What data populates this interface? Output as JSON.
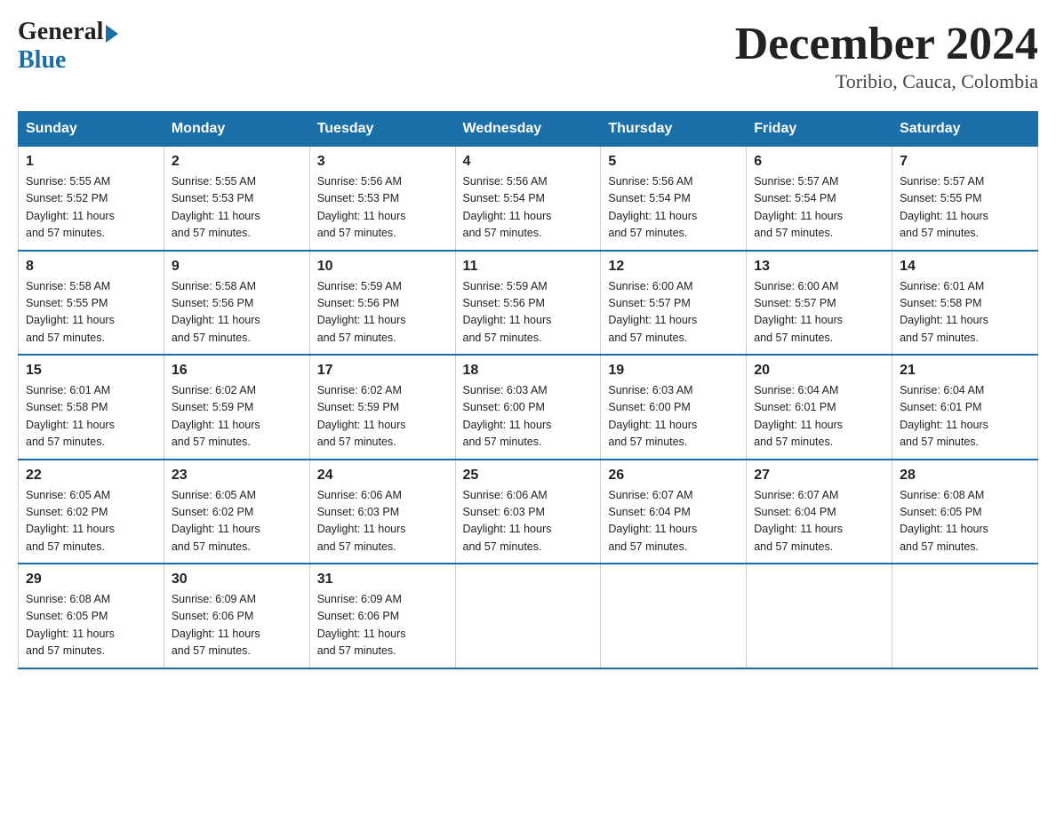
{
  "logo": {
    "general": "General",
    "blue": "Blue"
  },
  "title": "December 2024",
  "location": "Toribio, Cauca, Colombia",
  "days_of_week": [
    "Sunday",
    "Monday",
    "Tuesday",
    "Wednesday",
    "Thursday",
    "Friday",
    "Saturday"
  ],
  "weeks": [
    [
      {
        "day": "1",
        "sunrise": "5:55 AM",
        "sunset": "5:52 PM",
        "daylight": "11 hours and 57 minutes."
      },
      {
        "day": "2",
        "sunrise": "5:55 AM",
        "sunset": "5:53 PM",
        "daylight": "11 hours and 57 minutes."
      },
      {
        "day": "3",
        "sunrise": "5:56 AM",
        "sunset": "5:53 PM",
        "daylight": "11 hours and 57 minutes."
      },
      {
        "day": "4",
        "sunrise": "5:56 AM",
        "sunset": "5:54 PM",
        "daylight": "11 hours and 57 minutes."
      },
      {
        "day": "5",
        "sunrise": "5:56 AM",
        "sunset": "5:54 PM",
        "daylight": "11 hours and 57 minutes."
      },
      {
        "day": "6",
        "sunrise": "5:57 AM",
        "sunset": "5:54 PM",
        "daylight": "11 hours and 57 minutes."
      },
      {
        "day": "7",
        "sunrise": "5:57 AM",
        "sunset": "5:55 PM",
        "daylight": "11 hours and 57 minutes."
      }
    ],
    [
      {
        "day": "8",
        "sunrise": "5:58 AM",
        "sunset": "5:55 PM",
        "daylight": "11 hours and 57 minutes."
      },
      {
        "day": "9",
        "sunrise": "5:58 AM",
        "sunset": "5:56 PM",
        "daylight": "11 hours and 57 minutes."
      },
      {
        "day": "10",
        "sunrise": "5:59 AM",
        "sunset": "5:56 PM",
        "daylight": "11 hours and 57 minutes."
      },
      {
        "day": "11",
        "sunrise": "5:59 AM",
        "sunset": "5:56 PM",
        "daylight": "11 hours and 57 minutes."
      },
      {
        "day": "12",
        "sunrise": "6:00 AM",
        "sunset": "5:57 PM",
        "daylight": "11 hours and 57 minutes."
      },
      {
        "day": "13",
        "sunrise": "6:00 AM",
        "sunset": "5:57 PM",
        "daylight": "11 hours and 57 minutes."
      },
      {
        "day": "14",
        "sunrise": "6:01 AM",
        "sunset": "5:58 PM",
        "daylight": "11 hours and 57 minutes."
      }
    ],
    [
      {
        "day": "15",
        "sunrise": "6:01 AM",
        "sunset": "5:58 PM",
        "daylight": "11 hours and 57 minutes."
      },
      {
        "day": "16",
        "sunrise": "6:02 AM",
        "sunset": "5:59 PM",
        "daylight": "11 hours and 57 minutes."
      },
      {
        "day": "17",
        "sunrise": "6:02 AM",
        "sunset": "5:59 PM",
        "daylight": "11 hours and 57 minutes."
      },
      {
        "day": "18",
        "sunrise": "6:03 AM",
        "sunset": "6:00 PM",
        "daylight": "11 hours and 57 minutes."
      },
      {
        "day": "19",
        "sunrise": "6:03 AM",
        "sunset": "6:00 PM",
        "daylight": "11 hours and 57 minutes."
      },
      {
        "day": "20",
        "sunrise": "6:04 AM",
        "sunset": "6:01 PM",
        "daylight": "11 hours and 57 minutes."
      },
      {
        "day": "21",
        "sunrise": "6:04 AM",
        "sunset": "6:01 PM",
        "daylight": "11 hours and 57 minutes."
      }
    ],
    [
      {
        "day": "22",
        "sunrise": "6:05 AM",
        "sunset": "6:02 PM",
        "daylight": "11 hours and 57 minutes."
      },
      {
        "day": "23",
        "sunrise": "6:05 AM",
        "sunset": "6:02 PM",
        "daylight": "11 hours and 57 minutes."
      },
      {
        "day": "24",
        "sunrise": "6:06 AM",
        "sunset": "6:03 PM",
        "daylight": "11 hours and 57 minutes."
      },
      {
        "day": "25",
        "sunrise": "6:06 AM",
        "sunset": "6:03 PM",
        "daylight": "11 hours and 57 minutes."
      },
      {
        "day": "26",
        "sunrise": "6:07 AM",
        "sunset": "6:04 PM",
        "daylight": "11 hours and 57 minutes."
      },
      {
        "day": "27",
        "sunrise": "6:07 AM",
        "sunset": "6:04 PM",
        "daylight": "11 hours and 57 minutes."
      },
      {
        "day": "28",
        "sunrise": "6:08 AM",
        "sunset": "6:05 PM",
        "daylight": "11 hours and 57 minutes."
      }
    ],
    [
      {
        "day": "29",
        "sunrise": "6:08 AM",
        "sunset": "6:05 PM",
        "daylight": "11 hours and 57 minutes."
      },
      {
        "day": "30",
        "sunrise": "6:09 AM",
        "sunset": "6:06 PM",
        "daylight": "11 hours and 57 minutes."
      },
      {
        "day": "31",
        "sunrise": "6:09 AM",
        "sunset": "6:06 PM",
        "daylight": "11 hours and 57 minutes."
      },
      null,
      null,
      null,
      null
    ]
  ],
  "labels": {
    "sunrise": "Sunrise:",
    "sunset": "Sunset:",
    "daylight": "Daylight:"
  }
}
